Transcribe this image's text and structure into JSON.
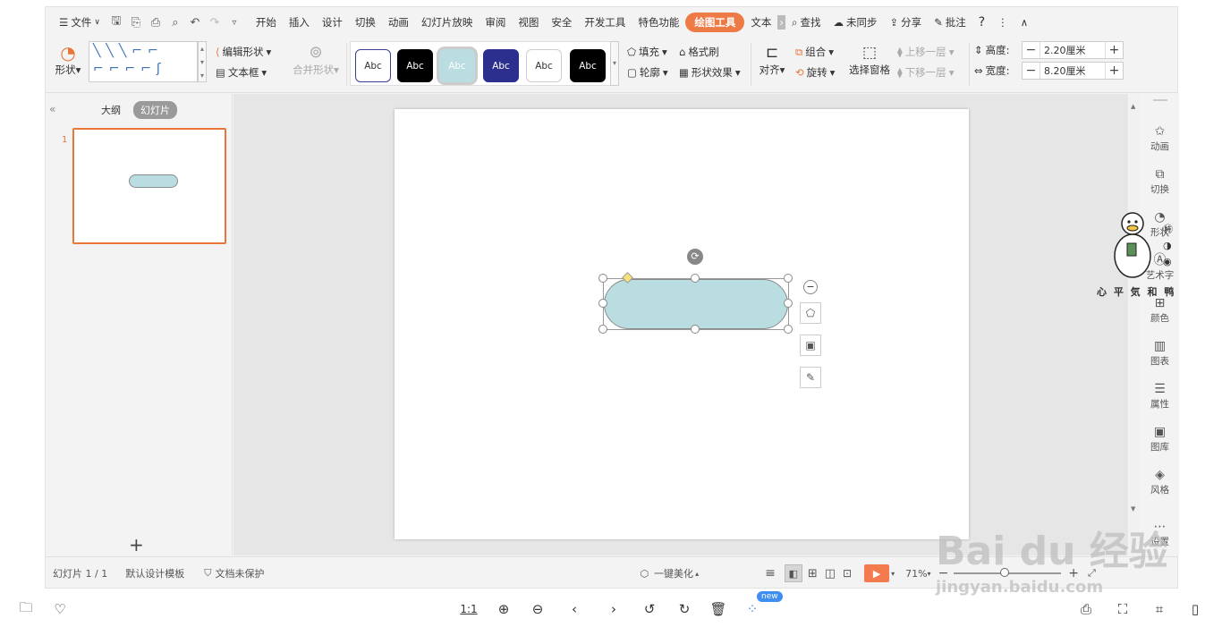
{
  "menu": {
    "file": "文件",
    "tabs": [
      "开始",
      "插入",
      "设计",
      "切换",
      "动画",
      "幻灯片放映",
      "审阅",
      "视图",
      "安全",
      "开发工具",
      "特色功能"
    ],
    "active_tab": "绘图工具",
    "more_tab": "文本",
    "search": "查找",
    "sync": "未同步",
    "share": "分享",
    "comment": "批注",
    "help": "?"
  },
  "ribbon": {
    "shape_label": "形状",
    "edit_shape": "编辑形状",
    "text_box": "文本框",
    "merge_shape": "合并形状",
    "style_text": "Abc",
    "fill": "填充",
    "outline": "轮廓",
    "format_brush": "格式刷",
    "shape_effect": "形状效果",
    "align": "对齐",
    "group": "组合",
    "rotate": "旋转",
    "select_pane": "选择窗格",
    "bring_forward": "上移一层",
    "send_backward": "下移一层",
    "height_label": "高度:",
    "height_value": "2.20厘米",
    "width_label": "宽度:",
    "width_value": "8.20厘米"
  },
  "styles": [
    {
      "bg": "#ffffff",
      "fg": "#333333",
      "border": "#3b3f8f"
    },
    {
      "bg": "#000000",
      "fg": "#ffffff",
      "border": "#000000"
    },
    {
      "bg": "#b9dde0",
      "fg": "#ffffff",
      "border": "#b9dde0"
    },
    {
      "bg": "#2d2f8e",
      "fg": "#ffffff",
      "border": "#2d2f8e"
    },
    {
      "bg": "#ffffff",
      "fg": "#333333",
      "border": "#cccccc"
    },
    {
      "bg": "#000000",
      "fg": "#ffffff",
      "border": "#000000"
    }
  ],
  "left_panel": {
    "outline_tab": "大纲",
    "slides_tab": "幻灯片",
    "slide_number": "1",
    "add": "+"
  },
  "right_panel": [
    {
      "icon": "star",
      "label": "动画"
    },
    {
      "icon": "switch",
      "label": "切换"
    },
    {
      "icon": "shape",
      "label": "形状"
    },
    {
      "icon": "art",
      "label": "艺术字"
    },
    {
      "icon": "color",
      "label": "颜色"
    },
    {
      "icon": "chart",
      "label": "图表"
    },
    {
      "icon": "props",
      "label": "属性"
    },
    {
      "icon": "image",
      "label": "图库"
    },
    {
      "icon": "style",
      "label": "风格"
    },
    {
      "icon": "more",
      "label": "设置"
    }
  ],
  "status": {
    "slide_info": "幻灯片 1 / 1",
    "template": "默认设计模板",
    "protection": "文档未保护",
    "beautify": "一键美化",
    "zoom": "71%"
  },
  "bottom": {
    "ratio": "1:1",
    "new_badge": "new"
  },
  "watermark": {
    "duck_text": "心 平 気 和 鸭",
    "baidu": "Bai du 经验",
    "url": "jingyan.baidu.com"
  },
  "colors": {
    "accent": "#ee7a45",
    "shape_fill": "#b9dde0",
    "play": "#f47b4f"
  }
}
